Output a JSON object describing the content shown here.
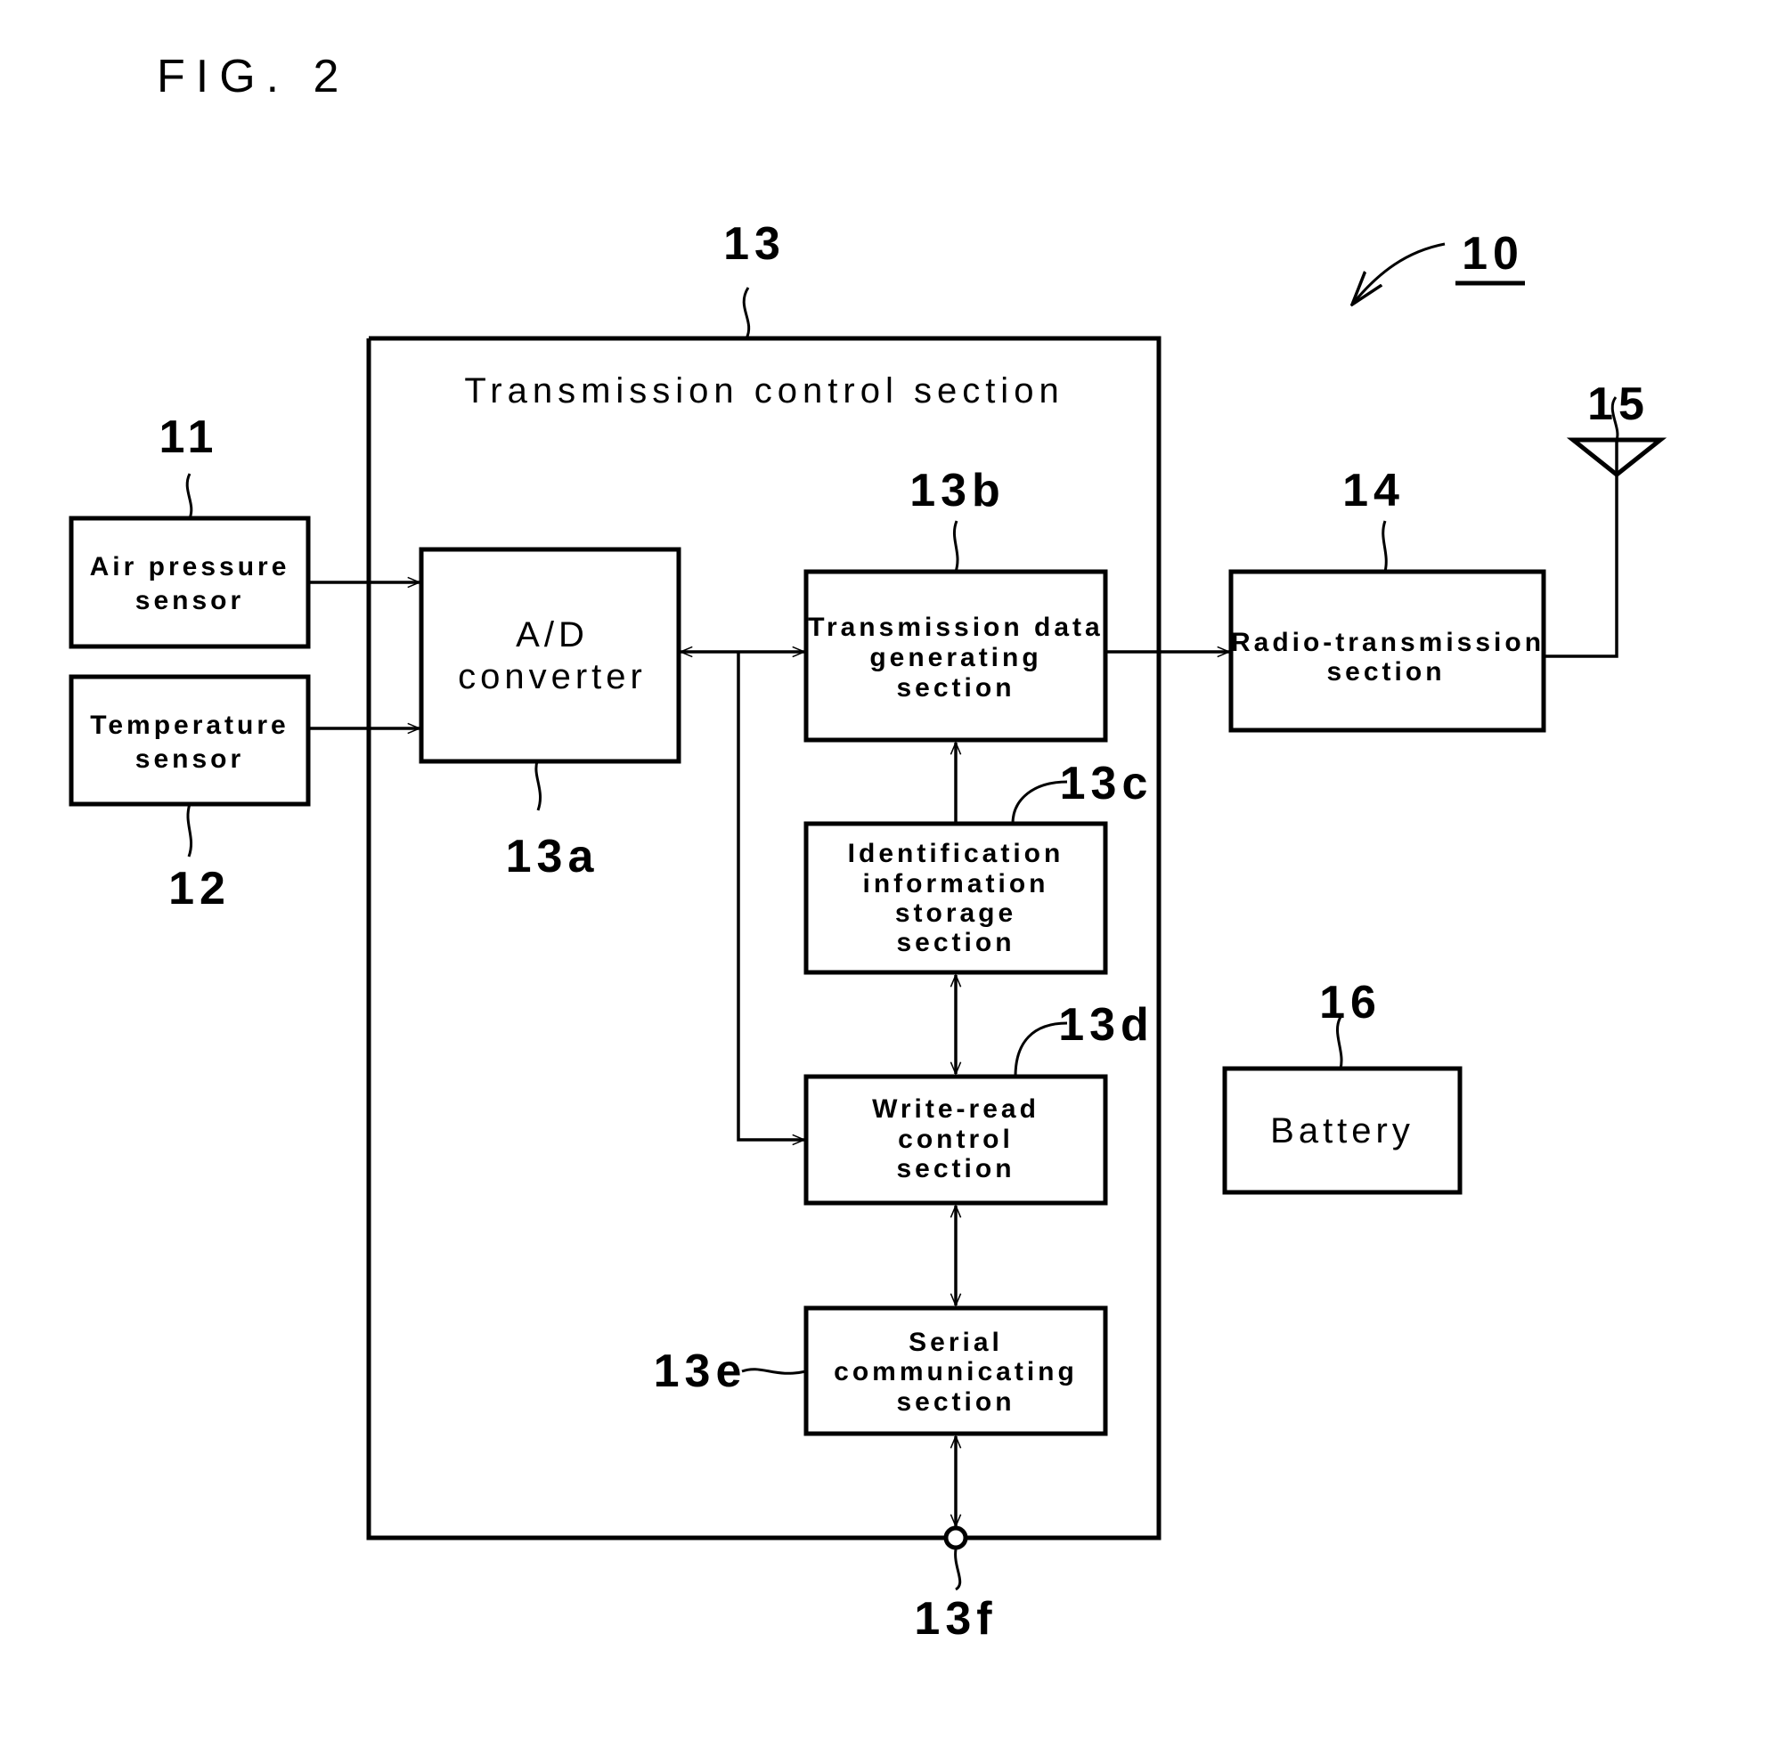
{
  "figure": {
    "label": "FIG. 2",
    "device_ref": "10"
  },
  "control_section": {
    "ref": "13",
    "title": "Transmission control section",
    "terminal_ref": "13f"
  },
  "sensors": [
    {
      "ref": "11",
      "lines": [
        "Air pressure",
        "sensor"
      ]
    },
    {
      "ref": "12",
      "lines": [
        "Temperature",
        "sensor"
      ]
    }
  ],
  "blocks": {
    "ad": {
      "ref": "13a",
      "lines": [
        "A/D",
        "converter"
      ]
    },
    "tdg": {
      "ref": "13b",
      "lines": [
        "Transmission data",
        "generating",
        "section"
      ]
    },
    "iis": {
      "ref": "13c",
      "lines": [
        "Identification",
        "information",
        "storage",
        "section"
      ]
    },
    "wrc": {
      "ref": "13d",
      "lines": [
        "Write-read",
        "control",
        "section"
      ]
    },
    "sc": {
      "ref": "13e",
      "lines": [
        "Serial",
        "communicating",
        "section"
      ]
    },
    "radio": {
      "ref": "14",
      "lines": [
        "Radio-transmission",
        "section"
      ]
    },
    "battery": {
      "ref": "16",
      "lines": [
        "Battery"
      ]
    }
  },
  "antenna": {
    "ref": "15",
    "icon": "antenna-icon"
  },
  "connections": [
    {
      "from": "Air pressure sensor",
      "to": "A/D converter",
      "type": "arrow"
    },
    {
      "from": "Temperature sensor",
      "to": "A/D converter",
      "type": "arrow"
    },
    {
      "from": "A/D converter",
      "to": "Transmission data generating section",
      "type": "bidirectional"
    },
    {
      "from": "A/D converter",
      "to": "Write-read control section",
      "type": "arrow"
    },
    {
      "from": "Identification information storage section",
      "to": "Transmission data generating section",
      "type": "arrow"
    },
    {
      "from": "Identification information storage section",
      "to": "Write-read control section",
      "type": "bidirectional"
    },
    {
      "from": "Write-read control section",
      "to": "Serial communicating section",
      "type": "bidirectional"
    },
    {
      "from": "Serial communicating section",
      "to": "13f",
      "type": "bidirectional"
    },
    {
      "from": "Transmission data generating section",
      "to": "Radio-transmission section",
      "type": "arrow"
    },
    {
      "from": "Radio-transmission section",
      "to": "Antenna 15",
      "type": "line"
    }
  ]
}
